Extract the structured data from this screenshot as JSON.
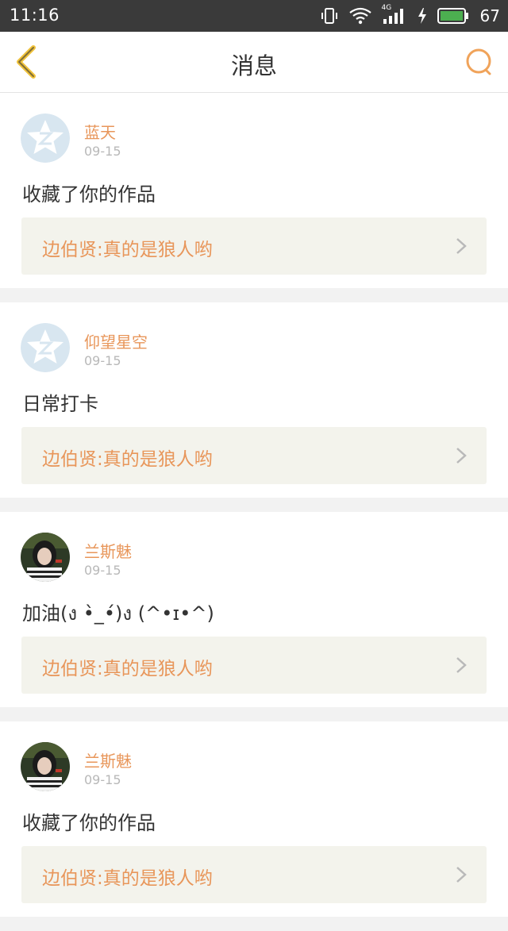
{
  "status_bar": {
    "time": "11:16",
    "network_label": "4G",
    "battery_level": "67",
    "icons": [
      "vibrate-icon",
      "wifi-icon",
      "signal-icon",
      "charging-icon",
      "battery-icon"
    ]
  },
  "header": {
    "title": "消息",
    "back_icon": "chevron-left-icon",
    "search_icon": "search-icon",
    "accent_color": "#f0a35a"
  },
  "messages": [
    {
      "name": "蓝天",
      "date": "09-15",
      "text": "收藏了你的作品",
      "quote": "边伯贤:真的是狼人哟",
      "avatar": "default-qzone-avatar"
    },
    {
      "name": "仰望星空",
      "date": "09-15",
      "text": "日常打卡",
      "quote": "边伯贤:真的是狼人哟",
      "avatar": "default-qzone-avatar"
    },
    {
      "name": "兰斯魅",
      "date": "09-15",
      "text": "加油(ง •̀_•́)ง (^•ɪ•^)",
      "quote": "边伯贤:真的是狼人哟",
      "avatar": "photo-avatar"
    },
    {
      "name": "兰斯魅",
      "date": "09-15",
      "text": "收藏了你的作品",
      "quote": "边伯贤:真的是狼人哟",
      "avatar": "photo-avatar"
    }
  ],
  "colors": {
    "name_color": "#e8965a",
    "quote_bg": "#f3f3ec",
    "page_bg": "#f2f2f2"
  }
}
